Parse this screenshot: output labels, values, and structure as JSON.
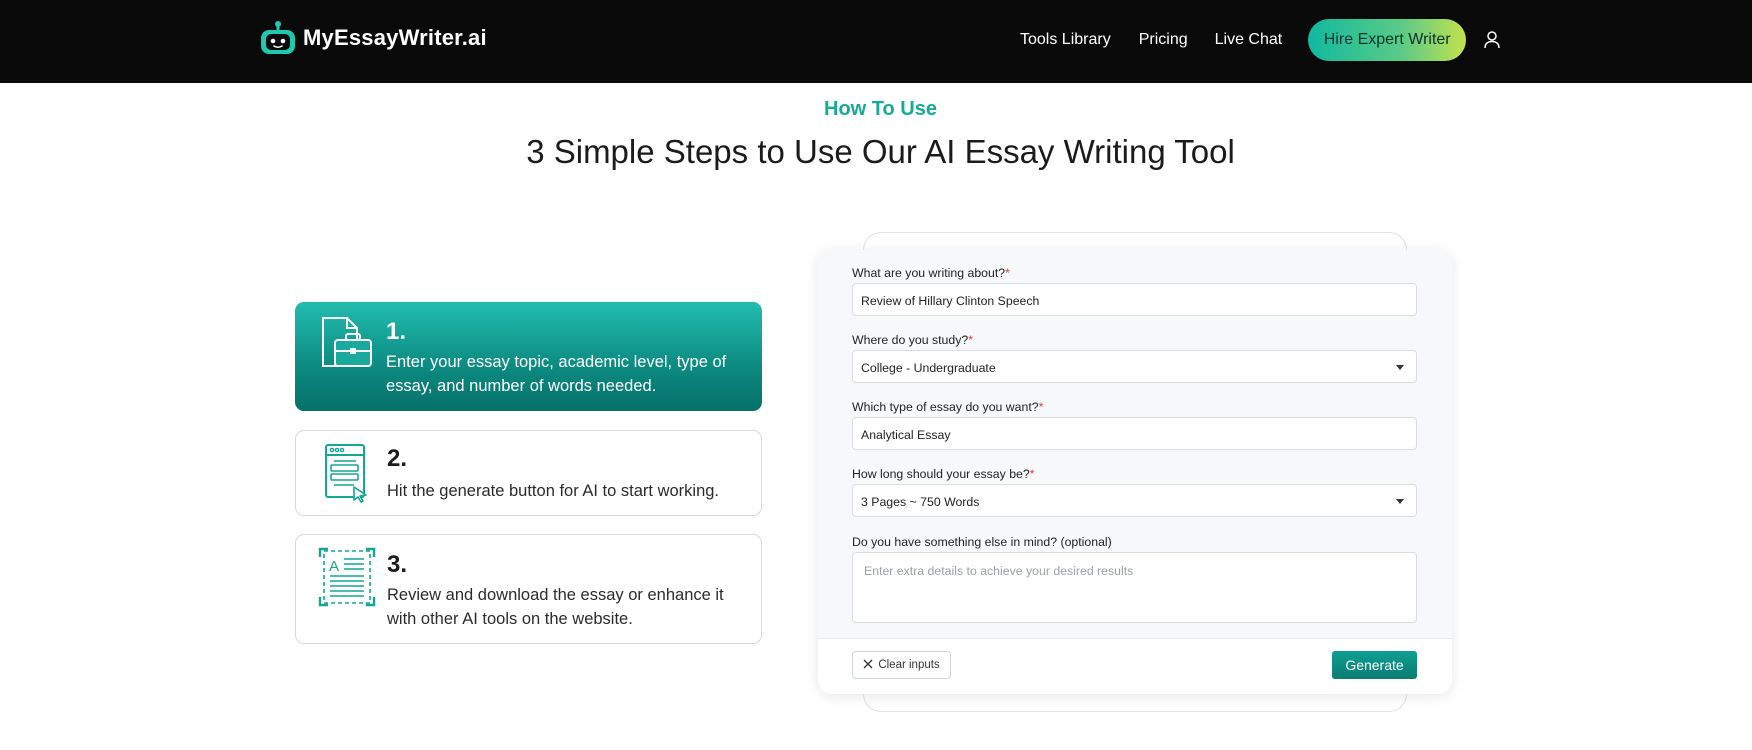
{
  "header": {
    "brand": "MyEssayWriter.ai",
    "nav": [
      {
        "label": "Tools Library"
      },
      {
        "label": "Pricing"
      },
      {
        "label": "Live Chat"
      }
    ],
    "cta_label": "Hire Expert Writer",
    "user_icon": "user-icon"
  },
  "section": {
    "eyebrow": "How To Use",
    "title": "3 Simple Steps to Use Our AI Essay Writing Tool"
  },
  "steps": [
    {
      "number": "1.",
      "text": "Enter your essay topic, academic level, type of essay, and number of words needed.",
      "icon": "document-briefcase-icon",
      "active": true
    },
    {
      "number": "2.",
      "text": "Hit the generate button for AI to start working.",
      "icon": "document-click-icon",
      "active": false
    },
    {
      "number": "3.",
      "text": "Review and download the essay or enhance it with other AI tools on the website.",
      "icon": "ai-document-icon",
      "active": false
    }
  ],
  "form": {
    "topic": {
      "label": "What are you writing about?",
      "required": "*",
      "value": "Review of Hillary Clinton Speech"
    },
    "level": {
      "label": "Where do you study?",
      "required": "*",
      "value": "College - Undergraduate"
    },
    "type": {
      "label": "Which type of essay do you want?",
      "required": "*",
      "value": "Analytical Essay"
    },
    "length": {
      "label": "How long should your essay be?",
      "required": "*",
      "value": "3 Pages ~ 750 Words"
    },
    "extra": {
      "label": "Do you have something else in mind? (optional)",
      "placeholder": "Enter extra details to achieve your desired results"
    },
    "clear_label": "Clear inputs",
    "generate_label": "Generate"
  },
  "colors": {
    "accent": "#16aa97",
    "header_bg": "#0a0a0a",
    "required": "#e53935"
  }
}
